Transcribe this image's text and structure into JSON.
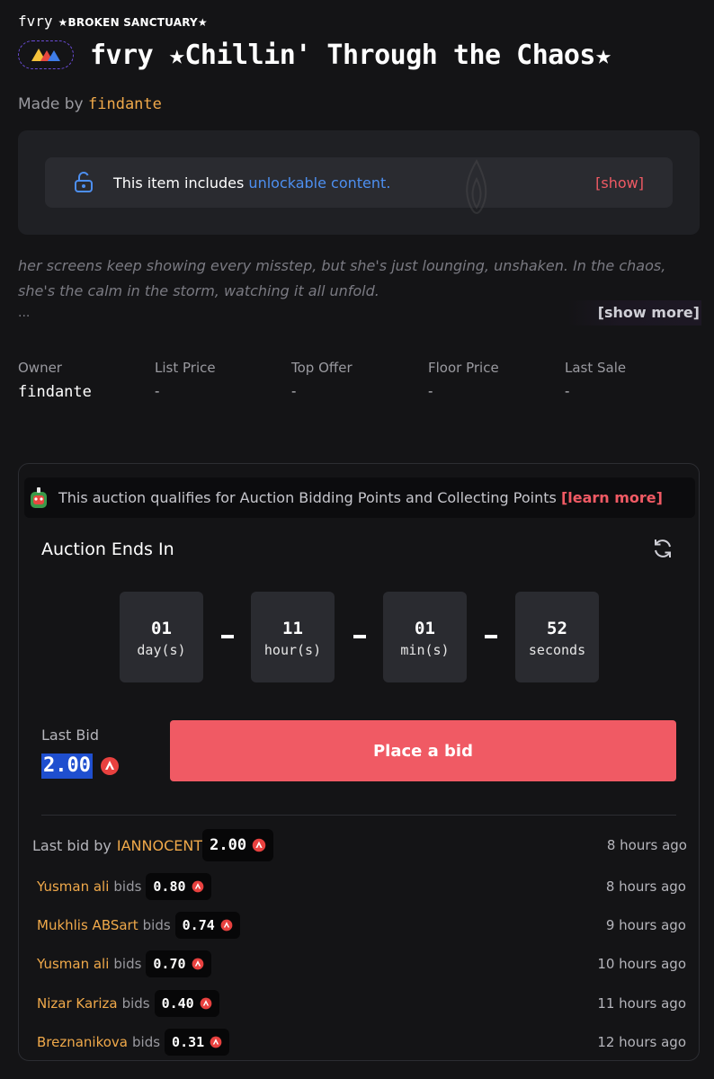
{
  "collection": {
    "name": "fvry",
    "subtitle": "★BROKEN SANCTUARY★"
  },
  "item": {
    "title": "fvry ★Chillin' Through the Chaos★",
    "made_by_label": "Made by",
    "creator": "findante",
    "unlockable": {
      "text_prefix": "This item includes",
      "link_text": "unlockable content.",
      "show_label": "[show]"
    },
    "description": "her screens keep showing every misstep, but she's just lounging, unshaken. In the chaos, she's the calm in the storm, watching it all unfold.",
    "ellipsis": "...",
    "show_more_label": "[show more]"
  },
  "stats": [
    {
      "label": "Owner",
      "value": "findante"
    },
    {
      "label": "List Price",
      "value": "-"
    },
    {
      "label": "Top Offer",
      "value": "-"
    },
    {
      "label": "Floor Price",
      "value": "-"
    },
    {
      "label": "Last Sale",
      "value": "-"
    }
  ],
  "auction": {
    "points_text": "This auction qualifies for Auction Bidding Points and Collecting Points",
    "learn_more_label": "[learn more]",
    "ends_in_label": "Auction Ends In",
    "countdown": [
      {
        "value": "01",
        "unit": "day(s)"
      },
      {
        "value": "11",
        "unit": "hour(s)"
      },
      {
        "value": "01",
        "unit": "min(s)"
      },
      {
        "value": "52",
        "unit": "seconds"
      }
    ],
    "last_bid_label": "Last Bid",
    "last_bid_value": "2.00",
    "place_bid_label": "Place a bid",
    "last_bid_by": {
      "label": "Last bid by",
      "bidder": "IANNOCENT",
      "amount": "2.00",
      "time": "8 hours ago"
    },
    "bids_word": "bids",
    "bid_history": [
      {
        "bidder": "Yusman ali",
        "amount": "0.80",
        "time": "8 hours ago"
      },
      {
        "bidder": "Mukhlis ABSart",
        "amount": "0.74",
        "time": "9 hours ago"
      },
      {
        "bidder": "Yusman ali",
        "amount": "0.70",
        "time": "10 hours ago"
      },
      {
        "bidder": "Nizar Kariza",
        "amount": "0.40",
        "time": "11 hours ago"
      },
      {
        "bidder": "Breznanikova",
        "amount": "0.31",
        "time": "12 hours ago"
      }
    ]
  },
  "colors": {
    "accent_red": "#f05a64",
    "creator_orange": "#f0a94a",
    "link_blue": "#4d8ff0",
    "background": "#141416"
  },
  "icons": {
    "chain": "avax-chain-icon",
    "currency": "avax-icon",
    "unlock": "unlock-icon",
    "refresh": "refresh-icon"
  }
}
